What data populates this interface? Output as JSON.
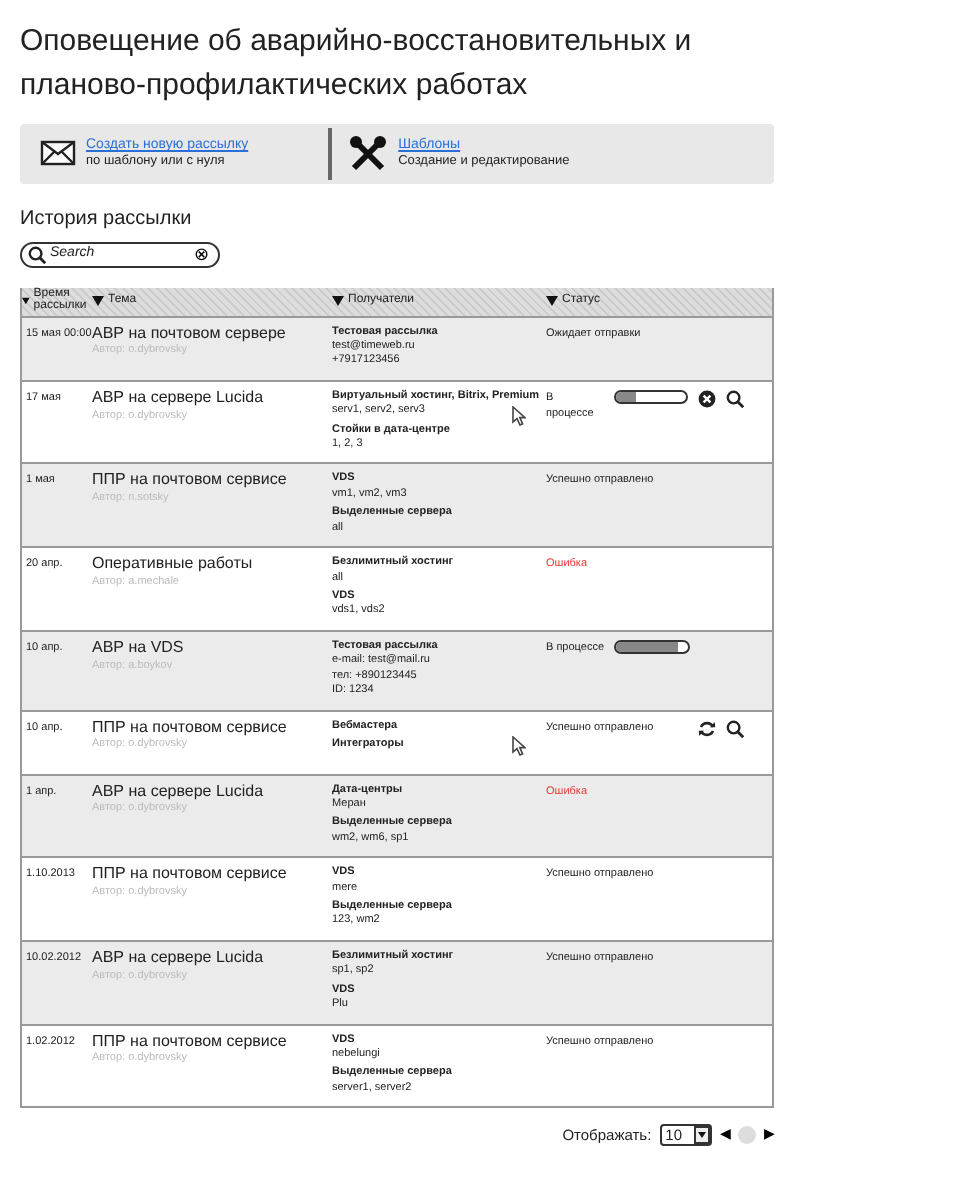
{
  "title": "Оповещение об аварийно-восстановительных и планово-профилактических работах",
  "toolbar": [
    {
      "kind": "mail",
      "link": "Создать новую рассылку",
      "caption": "по шаблону или с нуля"
    },
    {
      "kind": "tools",
      "link": "Шаблоны",
      "caption": "Создание и редактирование"
    }
  ],
  "history": {
    "heading": "История рассылки",
    "search": {
      "placeholder": "Search",
      "clear": "⊗"
    }
  },
  "table": {
    "columns": [
      "Время рассылки",
      "Тема",
      "Получатели",
      "Статус"
    ],
    "rows": [
      {
        "time": "15 мая 00:00",
        "subject": "АВР на почтовом сервере",
        "author": "Автор: o.dybrovsky",
        "recipients": [
          {
            "title": "Тестовая рассылка",
            "lines": [
              "test@timeweb.ru",
              "+7917123456"
            ]
          }
        ],
        "status": {
          "kind": "pending",
          "text": "Ожидает отправки"
        },
        "actions": [],
        "cursor": false
      },
      {
        "time": "17 мая",
        "subject": "АВР на сервере Lucida",
        "author": "Автор: o.dybrovsky",
        "recipients": [
          {
            "title": "Виртуальный хостинг, Bitrix, Premium",
            "lines": [
              "serv1, serv2, serv3"
            ]
          },
          {
            "title": "Стойки в дата-центре",
            "lines": [
              "1, 2, 3"
            ]
          }
        ],
        "status": {
          "kind": "progress",
          "text": "В процессе",
          "level": 0.3
        },
        "actions": [
          {
            "kind": "cancel"
          },
          {
            "kind": "search"
          }
        ],
        "cursor": true
      },
      {
        "time": "1 мая",
        "subject": "ППР на почтовом сервисе",
        "author": "Автор: n.sotsky",
        "recipients": [
          {
            "title": "VDS",
            "lines": [
              "vm1, vm2, vm3"
            ]
          },
          {
            "title": "Выделенные сервера",
            "lines": [
              "all"
            ]
          }
        ],
        "status": {
          "kind": "success",
          "text": "Успешно отправлено"
        },
        "actions": [],
        "cursor": false
      },
      {
        "time": "20 апр.",
        "subject": "Оперативные работы",
        "author": "Автор: a.mechale",
        "recipients": [
          {
            "title": "Безлимитный хостинг",
            "lines": [
              "all"
            ]
          },
          {
            "title": "VDS",
            "lines": [
              "vds1, vds2"
            ]
          }
        ],
        "status": {
          "kind": "error",
          "text": "Ошибка"
        },
        "actions": [],
        "cursor": false
      },
      {
        "time": "10 апр.",
        "subject": "АВР на VDS",
        "author": "Автор: a.boykov",
        "recipients": [
          {
            "title": "Тестовая рассылка",
            "lines": [
              "e-mail: test@mail.ru",
              "тел: +890123445",
              "ID: 1234"
            ]
          }
        ],
        "status": {
          "kind": "progress",
          "text": "В процессе",
          "level": 0.85
        },
        "actions": [],
        "cursor": false
      },
      {
        "time": "10 апр.",
        "subject": "ППР на почтовом сервисе",
        "author": "Автор: o.dybrovsky",
        "recipients": [
          {
            "title": "Вебмастера"
          },
          {
            "title": "Интеграторы"
          }
        ],
        "status": {
          "kind": "success",
          "text": "Успешно отправлено"
        },
        "actions": [
          {
            "kind": "refresh"
          },
          {
            "kind": "search"
          }
        ],
        "cursor": true
      },
      {
        "time": "1 апр.",
        "subject": "АВР на сервере Lucida",
        "author": "Автор: o.dybrovsky",
        "recipients": [
          {
            "title": "Дата-центры",
            "lines": [
              "Меран"
            ]
          },
          {
            "title": "Выделенные сервера",
            "lines": [
              "wm2, wm6, sp1"
            ]
          }
        ],
        "status": {
          "kind": "error",
          "text": "Ошибка"
        },
        "actions": [],
        "cursor": false
      },
      {
        "time": "1.10.2013",
        "subject": "ППР на почтовом сервисе",
        "author": "Автор: o.dybrovsky",
        "recipients": [
          {
            "title": "VDS",
            "lines": [
              "mere"
            ]
          },
          {
            "title": "Выделенные сервера",
            "lines": [
              "123, wm2"
            ]
          }
        ],
        "status": {
          "kind": "success",
          "text": "Успешно отправлено"
        },
        "actions": [],
        "cursor": false
      },
      {
        "time": "10.02.2012",
        "subject": "АВР на сервере Lucida",
        "author": "Автор: o.dybrovsky",
        "recipients": [
          {
            "title": "Безлимитный хостинг",
            "lines": [
              "sp1, sp2"
            ]
          },
          {
            "title": "VDS",
            "lines": [
              "Plu"
            ]
          }
        ],
        "status": {
          "kind": "success",
          "text": "Успешно отправлено"
        },
        "actions": [],
        "cursor": false
      },
      {
        "time": "1.02.2012",
        "subject": "ППР на почтовом сервисе",
        "author": "Автор: o.dybrovsky",
        "recipients": [
          {
            "title": "VDS",
            "lines": [
              "nebelungi"
            ]
          },
          {
            "title": "Выделенные сервера",
            "lines": [
              "server1, server2"
            ]
          }
        ],
        "status": {
          "kind": "success",
          "text": "Успешно отправлено"
        },
        "actions": [],
        "cursor": false
      }
    ]
  },
  "footer": {
    "label": "Отображать:",
    "page_size": "10",
    "prev": "◀",
    "next": "▶"
  }
}
